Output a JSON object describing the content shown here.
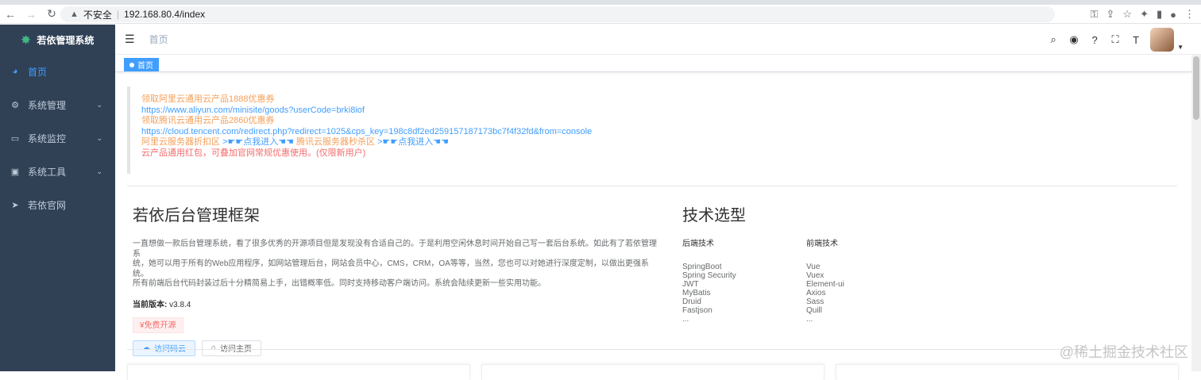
{
  "browser": {
    "security_label": "不安全",
    "url": "192.168.80.4/index"
  },
  "sidebar": {
    "logo_text": "若依管理系统",
    "items": [
      {
        "label": "首页",
        "icon": "dashboard-icon",
        "active": true
      },
      {
        "label": "系统管理",
        "icon": "gear-icon",
        "chevron": true
      },
      {
        "label": "系统监控",
        "icon": "monitor-icon",
        "chevron": true
      },
      {
        "label": "系统工具",
        "icon": "toolbox-icon",
        "chevron": true
      },
      {
        "label": "若依官网",
        "icon": "send-icon"
      }
    ]
  },
  "navbar": {
    "breadcrumb": "首页",
    "icons": [
      "search-icon",
      "github-icon",
      "question-icon",
      "fullscreen-icon",
      "font-size-icon"
    ]
  },
  "tags": [
    {
      "label": "首页",
      "active": true
    }
  ],
  "notice": {
    "line1": "领取阿里云通用云产品1888优惠券",
    "line2": "https://www.aliyun.com/minisite/goods?userCode=brki8iof",
    "line3": "领取腾讯云通用云产品2860优惠券",
    "line4": "https://cloud.tencent.com/redirect.php?redirect=1025&cps_key=198c8df2ed259157187173bc7f4f32fd&from=console",
    "line5a": "阿里云服务器折扣区",
    "line5b": ">☛☛点我进入☚☚",
    "line5c": "腾讯云服务器秒杀区",
    "line5d": ">☛☛点我进入☚☚",
    "line6": "云产品通用红包，可叠加官网常规优惠使用。(仅限新用户)"
  },
  "intro": {
    "title": "若依后台管理框架",
    "desc1": "一直想做一款后台管理系统，看了很多优秀的开源项目但是发现没有合适自己的。于是利用空闲休息时间开始自己写一套后台系统。如此有了若依管理系",
    "desc2": "统，她可以用于所有的Web应用程序，如网站管理后台，网站会员中心，CMS，CRM，OA等等，当然，您也可以对她进行深度定制，以做出更强系统。",
    "desc3": "所有前端后台代码封装过后十分精简易上手，出错概率低。同时支持移动客户端访问。系统会陆续更新一些实用功能。",
    "version_label": "当前版本:",
    "version_value": "v3.8.4",
    "free_tag": "¥免费开源",
    "btn_gitee": "访问码云",
    "btn_home": "访问主页"
  },
  "tech": {
    "title": "技术选型",
    "backend_header": "后端技术",
    "frontend_header": "前端技术",
    "backend": [
      "SpringBoot",
      "Spring Security",
      "JWT",
      "MyBatis",
      "Druid",
      "Fastjson",
      "..."
    ],
    "frontend": [
      "Vue",
      "Vuex",
      "Element-ui",
      "Axios",
      "Sass",
      "Quill",
      "..."
    ]
  },
  "watermark": "@稀土掘金技术社区"
}
